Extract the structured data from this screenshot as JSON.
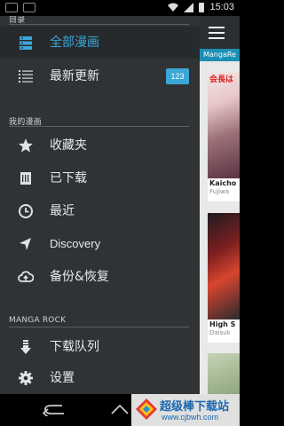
{
  "status_bar": {
    "time": "15:03"
  },
  "drawer": {
    "section_catalog": "目录",
    "catalog_items": [
      {
        "label": "全部漫画",
        "icon": "all-comics-icon",
        "active": true
      },
      {
        "label": "最新更新",
        "icon": "list-icon",
        "badge": "123"
      }
    ],
    "section_my": "我的漫画",
    "my_items": [
      {
        "label": "收藏夹",
        "icon": "star-icon"
      },
      {
        "label": "已下载",
        "icon": "downloaded-icon"
      },
      {
        "label": "最近",
        "icon": "clock-icon"
      },
      {
        "label": "Discovery",
        "icon": "navigation-arrow-icon"
      },
      {
        "label": "备份&恢复",
        "icon": "cloud-upload-icon"
      }
    ],
    "section_app": "MANGA ROCK",
    "app_items": [
      {
        "label": "下载队列",
        "icon": "download-queue-icon"
      },
      {
        "label": "设置",
        "icon": "gear-icon"
      }
    ]
  },
  "content": {
    "source_tab": "MangaRe",
    "covers": [
      {
        "title_art": "会長は",
        "caption": "Kaicho",
        "subcaption": "Fujiwa"
      },
      {
        "title_art": "",
        "caption": "High S",
        "subcaption": "Daisuk"
      },
      {
        "title_art": "",
        "caption": "",
        "subcaption": ""
      }
    ]
  },
  "watermark": {
    "title": "超级棒下载站",
    "url": "www.cjbwh.com"
  },
  "colors": {
    "accent": "#3aa7d6",
    "drawer_bg": "#2f3336",
    "tab_blue": "#1b8fb5"
  }
}
